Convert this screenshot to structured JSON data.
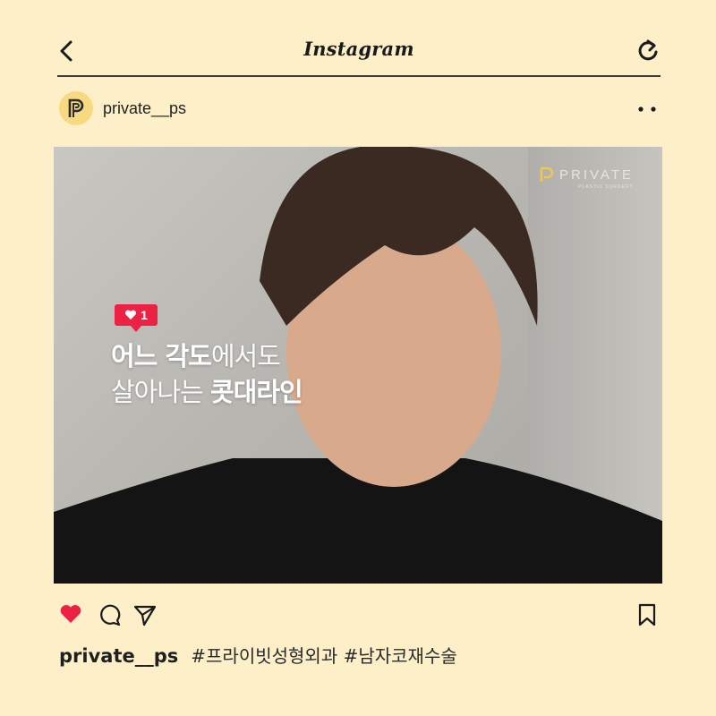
{
  "header": {
    "app_title": "Instagram",
    "back_icon": "chevron-left-icon",
    "refresh_icon": "refresh-icon"
  },
  "post": {
    "username": "private__ps",
    "more_icon": "more-dots-icon",
    "image": {
      "brand_name": "PRIVATE",
      "brand_sub": "PLASTIC SURGERY",
      "like_count": "1",
      "headline_line1_bold": "어느 각도",
      "headline_line1_light": "에서도",
      "headline_line2_light": "살아나는 ",
      "headline_line2_bold": "콧대라인"
    },
    "actions": {
      "like_icon": "heart-filled-icon",
      "comment_icon": "comment-icon",
      "share_icon": "send-icon",
      "save_icon": "bookmark-icon",
      "like_color": "#ec2244"
    },
    "caption": {
      "username": "private__ps",
      "hashtags": "#프라이빗성형외과 #남자코재수술"
    }
  },
  "colors": {
    "background": "#fdf0c9",
    "avatar": "#f6d980",
    "accent": "#ec2244"
  }
}
